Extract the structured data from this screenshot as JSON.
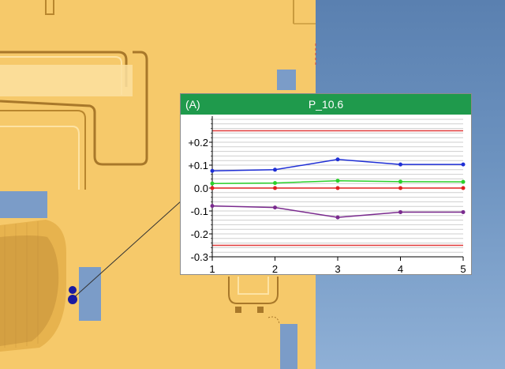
{
  "popup": {
    "label": "(A)",
    "title": "P_10.6"
  },
  "chart_data": {
    "type": "line",
    "title": "P_10.6",
    "x": [
      1,
      2,
      3,
      4,
      5
    ],
    "xlim": [
      1,
      5
    ],
    "ylim": [
      -0.3,
      0.3
    ],
    "y_ticks": [
      "+0.2",
      "+0.1",
      "0.0",
      "-0.1",
      "-0.2",
      "-0.3"
    ],
    "y_tick_values": [
      0.2,
      0.1,
      0.0,
      -0.1,
      -0.2,
      -0.3
    ],
    "x_ticks": [
      "1",
      "2",
      "3",
      "4",
      "5"
    ],
    "grid": true,
    "series": [
      {
        "color": "#1f2fd6",
        "values": [
          0.075,
          0.08,
          0.125,
          0.103,
          0.103
        ]
      },
      {
        "color": "#2ad02a",
        "values": [
          0.02,
          0.022,
          0.032,
          0.028,
          0.027
        ]
      },
      {
        "color": "#e02020",
        "values": [
          0.0,
          0.0,
          0.0,
          0.0,
          0.0
        ]
      },
      {
        "color": "#7a2a8e",
        "values": [
          -0.078,
          -0.085,
          -0.128,
          -0.105,
          -0.105
        ]
      }
    ],
    "limit_lines": [
      {
        "color": "#e03a3a",
        "value": 0.25
      },
      {
        "color": "#e03a3a",
        "value": -0.25
      }
    ]
  }
}
